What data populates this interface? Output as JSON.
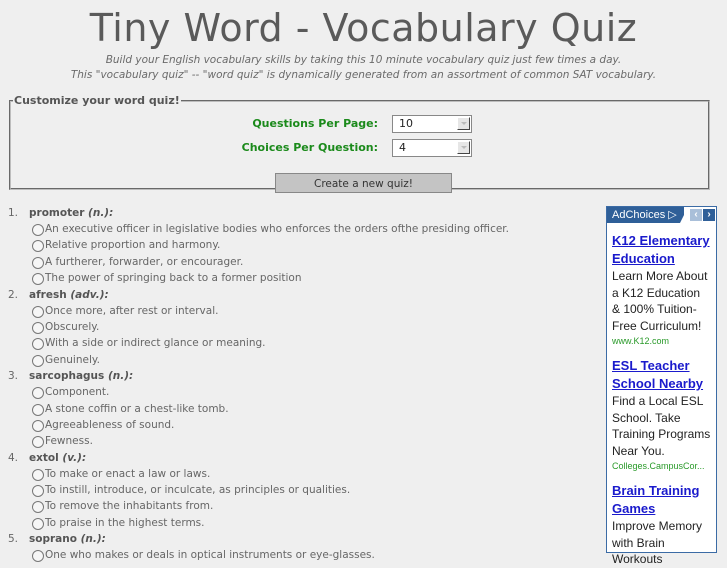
{
  "header": {
    "title": "Tiny Word - Vocabulary Quiz",
    "subtitle_line1": "Build your English vocabulary skills by taking this 10 minute vocabulary quiz just few times a day.",
    "subtitle_line2": "This \"vocabulary quiz\" -- \"word quiz\" is dynamically generated from an assortment of common SAT vocabulary."
  },
  "customize": {
    "legend": "Customize your word quiz!",
    "questions_label": "Questions Per Page:",
    "questions_value": "10",
    "choices_label": "Choices Per Question:",
    "choices_value": "4",
    "create_button": "Create a new quiz!"
  },
  "questions": [
    {
      "num": "1.",
      "word": "promoter",
      "pos": "(n.):",
      "choices": [
        "An executive officer in legislative bodies who enforces the orders ofthe presiding officer.",
        "Relative proportion and harmony.",
        "A furtherer, forwarder, or encourager.",
        "The power of springing back to a former position"
      ]
    },
    {
      "num": "2.",
      "word": "afresh",
      "pos": "(adv.):",
      "choices": [
        "Once more, after rest or interval.",
        "Obscurely.",
        "With a side or indirect glance or meaning.",
        "Genuinely."
      ]
    },
    {
      "num": "3.",
      "word": "sarcophagus",
      "pos": "(n.):",
      "choices": [
        "Component.",
        "A stone coffin or a chest-like tomb.",
        "Agreeableness of sound.",
        "Fewness."
      ]
    },
    {
      "num": "4.",
      "word": "extol",
      "pos": "(v.):",
      "choices": [
        "To make or enact a law or laws.",
        "To instill, introduce, or inculcate, as principles or qualities.",
        "To remove the inhabitants from.",
        "To praise in the highest terms."
      ]
    },
    {
      "num": "5.",
      "word": "soprano",
      "pos": "(n.):",
      "choices": [
        "One who makes or deals in optical instruments or eye-glasses."
      ]
    }
  ],
  "ad": {
    "adchoices_label": "AdChoices",
    "items": [
      {
        "title_line1": "K12 Elementary",
        "title_line2": "Education",
        "desc": "Learn More About a K12 Education & 100% Tuition-Free Curriculum!",
        "url": "www.K12.com"
      },
      {
        "title_line1": "ESL Teacher",
        "title_line2": "School Nearby",
        "desc": "Find a Local ESL School. Take Training Programs Near You.",
        "url": "Colleges.CampusCor..."
      },
      {
        "title_line1": "Brain Training",
        "title_line2": "Games",
        "desc": "Improve Memory with Brain Workouts",
        "url": ""
      }
    ]
  }
}
